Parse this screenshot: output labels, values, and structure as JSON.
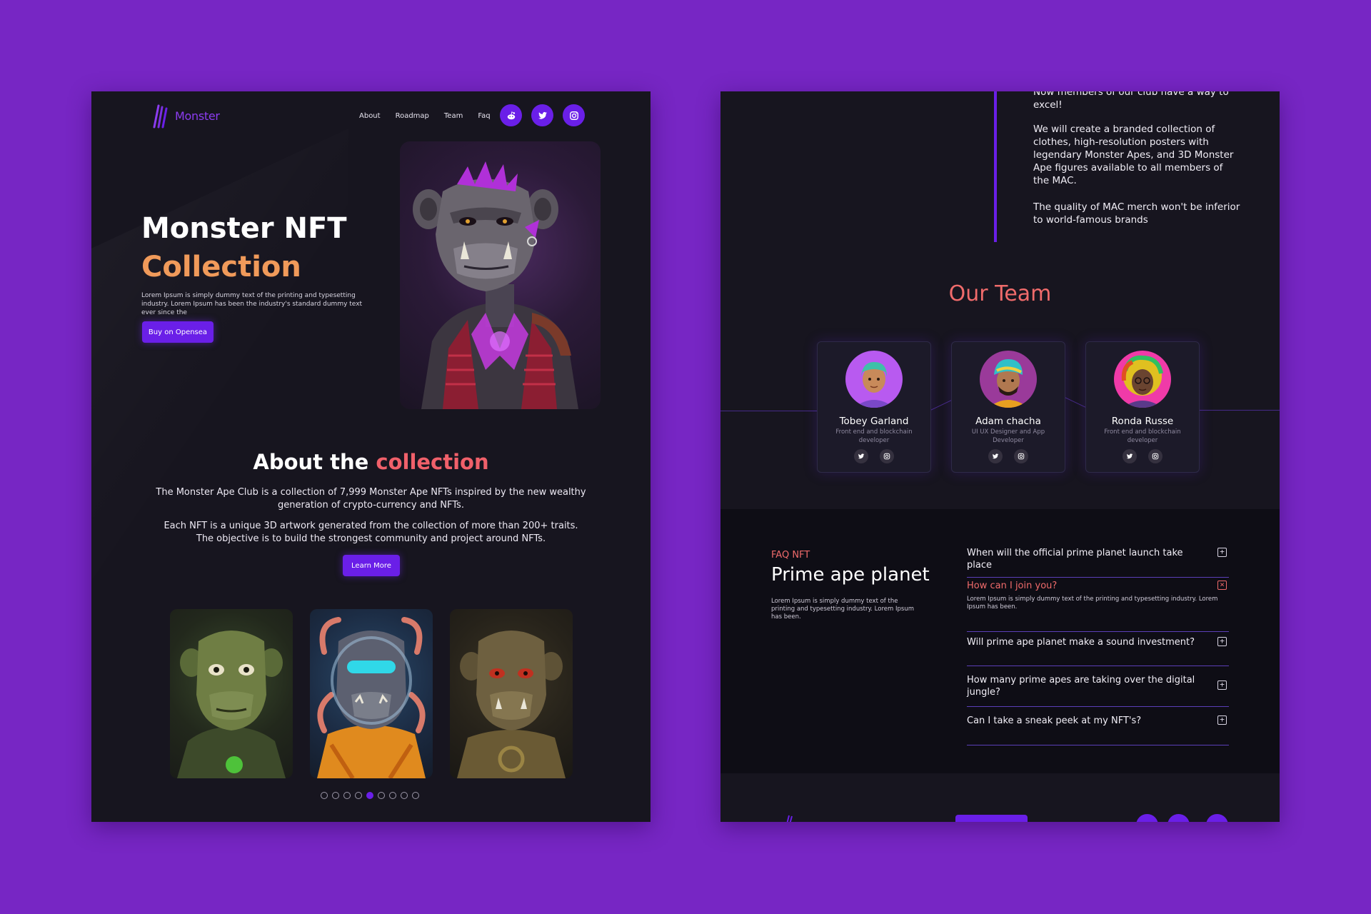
{
  "colors": {
    "page_bg": "#7726c4",
    "panel_bg": "#17151f",
    "accent_purple": "#6a1fe8",
    "accent_orange": "#f09a5a",
    "accent_coral": "#f06b6b"
  },
  "nav": {
    "logo_text": "Monster",
    "links": [
      "About",
      "Roadmap",
      "Team",
      "Faq"
    ],
    "social_icons": [
      "reddit-icon",
      "twitter-icon",
      "instagram-icon"
    ]
  },
  "hero": {
    "title_line1": "Monster NFT",
    "title_line2": "Collection",
    "description": "Lorem Ipsum is simply dummy text of the printing and typesetting industry. Lorem Ipsum has been the industry's standard dummy text ever since the",
    "button_label": "Buy on Opensea"
  },
  "about": {
    "title_part1": "About the ",
    "title_part2": "collection",
    "paragraph1": "The Monster Ape Club is a collection of 7,999 Monster Ape NFTs inspired by the new wealthy generation of crypto-currency and NFTs.",
    "paragraph2": "Each NFT is a unique 3D artwork generated from the collection of more than 200+ traits. The objective is to build the strongest community and project around NFTs.",
    "button_label": "Learn More",
    "carousel_dots": 9,
    "carousel_active": 5
  },
  "story": {
    "p1": "Now members of our club have a way to excel!",
    "p2": "We will create a branded collection of clothes, high-resolution posters with legendary Monster Apes, and 3D Monster Ape figures available to all members of the MAC.",
    "p3": "The quality of MAC merch won't be inferior to world-famous brands"
  },
  "team": {
    "title": "Our Team",
    "members": [
      {
        "name": "Tobey Garland",
        "role": "Front end and blockchain developer"
      },
      {
        "name": "Adam chacha",
        "role": "UI UX Designer and App Developer"
      },
      {
        "name": "Ronda Russe",
        "role": "Front end and blockchain developer"
      }
    ]
  },
  "faq": {
    "kicker": "FAQ NFT",
    "title": "Prime ape planet",
    "description": "Lorem Ipsum is simply dummy text of the printing and typesetting industry. Lorem Ipsum has been.",
    "items": [
      {
        "question": "When will the official prime planet launch take place",
        "open": false
      },
      {
        "question": "How can I join you?",
        "open": true,
        "answer": "Lorem Ipsum is simply dummy text of the printing and typesetting industry. Lorem Ipsum has been."
      },
      {
        "question": "Will prime ape planet make a sound investment?",
        "open": false
      },
      {
        "question": "How many prime apes are taking over the digital jungle?",
        "open": false
      },
      {
        "question": "Can I take a sneak peek at my NFT's?",
        "open": false
      }
    ]
  }
}
